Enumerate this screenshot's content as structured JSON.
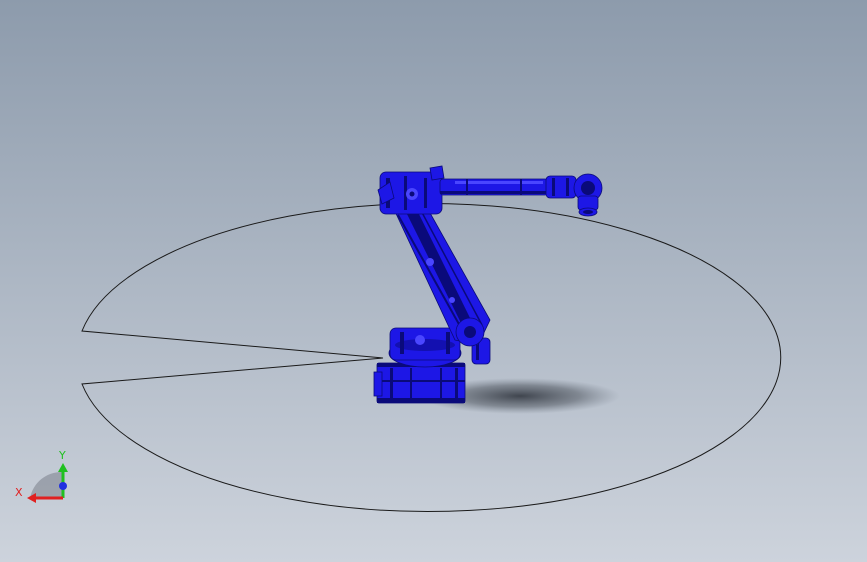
{
  "viewport": {
    "background_top": "#8d9bac",
    "background_bottom": "#cdd3dc"
  },
  "model": {
    "name": "robot-arm",
    "color": "#1d17e6",
    "dark_color": "#0a0a7a",
    "highlight_color": "#4a46ff"
  },
  "work_envelope": {
    "stroke_color": "#1a1a1a"
  },
  "triad": {
    "x_label": "X",
    "y_label": "Y",
    "x_color": "#e02020",
    "y_color": "#20c020",
    "z_color": "#2030e0"
  }
}
